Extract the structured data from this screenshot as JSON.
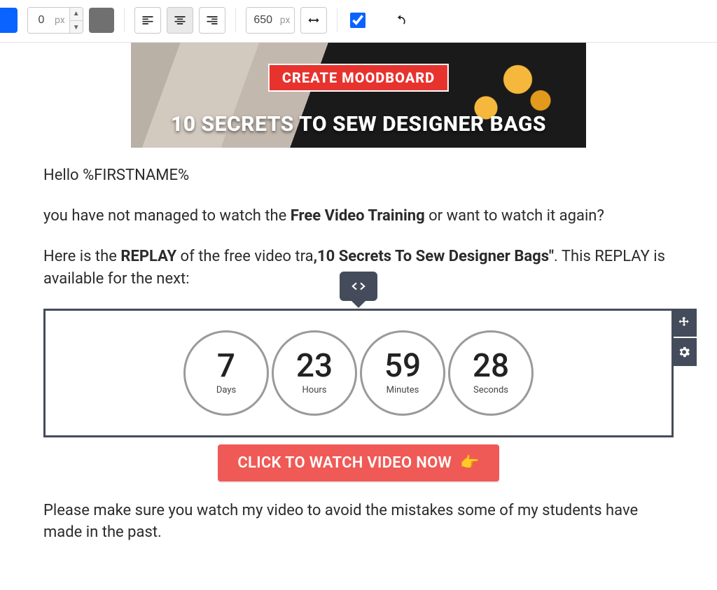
{
  "toolbar": {
    "border_width": "0",
    "border_unit": "px",
    "content_width": "650",
    "content_unit": "px",
    "checkbox_checked": true
  },
  "hero": {
    "badge": "CREATE MOODBOARD",
    "headline": "10 SECRETS TO SEW DESIGNER BAGS"
  },
  "email": {
    "greeting": "Hello %FIRSTNAME%",
    "p1_prefix": "you have not managed to watch the ",
    "p1_bold": "Free Video Training",
    "p1_suffix": " or want to watch it again?",
    "p2_prefix": "Here is the ",
    "p2_bold_replay": "REPLAY",
    "p2_mid": " of the free video tra",
    "p2_bold_title": ",10 Secrets To Sew Designer Bags\"",
    "p2_suffix": ". This REPLAY is available for the next:",
    "p3": "Please make sure you watch my video to avoid the mistakes some of my students have made in the past."
  },
  "countdown": {
    "days": {
      "value": "7",
      "label": "Days"
    },
    "hours": {
      "value": "23",
      "label": "Hours"
    },
    "minutes": {
      "value": "59",
      "label": "Minutes"
    },
    "seconds": {
      "value": "28",
      "label": "Seconds"
    }
  },
  "cta": {
    "label": "CLICK TO WATCH VIDEO NOW",
    "emoji": "👉"
  }
}
